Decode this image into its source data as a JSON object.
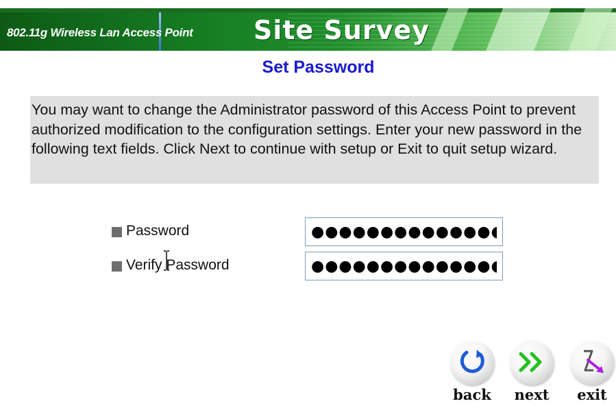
{
  "header": {
    "subtitle": "802.11g Wireless Lan Access Point",
    "title": "Site Survey"
  },
  "page": {
    "heading": "Set Password",
    "description": "You may want to change the Administrator password of this Access Point to prevent authorized modification to the configuration settings. Enter your new password in the following text fields. Click Next to continue with setup or Exit to quit setup wizard."
  },
  "form": {
    "password": {
      "label": "Password",
      "value": "●●●●●●●●●●●●●●●"
    },
    "verify_password": {
      "label": "Verify Password",
      "value": "●●●●●●●●●●●●●●●"
    }
  },
  "nav": {
    "back_label": "back",
    "next_label": "next",
    "exit_label": "exit"
  },
  "colors": {
    "banner_green": "#1f8f2c",
    "heading_blue": "#1a1ad0",
    "desc_background": "#e0e0e0",
    "bullet_gray": "#6e6e6e",
    "back_icon_blue": "#1e5bd6",
    "next_icon_green": "#22c11e",
    "exit_icon_purple": "#b01ee0"
  },
  "icons": {
    "back": "circular-arrow-icon",
    "next": "double-chevron-right-icon",
    "exit": "exit-arrow-icon"
  }
}
